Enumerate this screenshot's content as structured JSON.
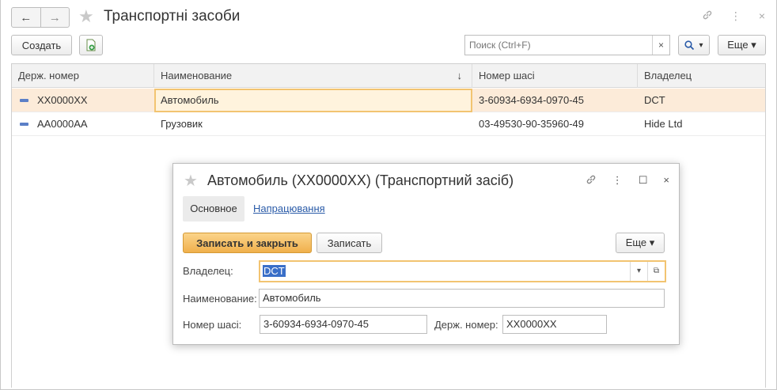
{
  "main": {
    "title": "Транспортні засоби",
    "nav_back": "←",
    "nav_forward": "→",
    "title_icons": {
      "link": "🔗",
      "more": "⋮",
      "close": "×"
    },
    "toolbar": {
      "create_label": "Создать",
      "search_placeholder": "Поиск (Ctrl+F)",
      "search_clear": "×",
      "search_icon": "🔍",
      "search_dropdown": "▾",
      "more_label": "Еще ▾"
    },
    "table": {
      "columns": [
        "Держ. номер",
        "Наименование",
        "Номер шасі",
        "Владелец"
      ],
      "sort_indicator": "↓",
      "rows": [
        {
          "plate": "XX0000XX",
          "name": "Автомобиль",
          "chassis": "3-60934-6934-0970-45",
          "owner": "DCT"
        },
        {
          "plate": "AA0000AA",
          "name": "Грузовик",
          "chassis": "03-49530-90-35960-49",
          "owner": "Hide Ltd"
        }
      ]
    }
  },
  "dialog": {
    "title": "Автомобиль (XX0000XX) (Транспортний засіб)",
    "icons": {
      "link": "🔗",
      "more": "⋮",
      "maximize": "☐",
      "close": "×"
    },
    "tabs": {
      "main": "Основное",
      "link": "Напрацювання"
    },
    "buttons": {
      "save_close": "Записать и закрыть",
      "save": "Записать",
      "more": "Еще ▾"
    },
    "fields": {
      "owner_label": "Владелец:",
      "owner_value": "DCT",
      "name_label": "Наименование:",
      "name_value": "Автомобиль",
      "chassis_label": "Номер шасі:",
      "chassis_value": "3-60934-6934-0970-45",
      "plate_label": "Держ. номер:",
      "plate_value": "XX0000XX",
      "dropdown_glyph": "▾",
      "open_glyph": "⧉"
    }
  },
  "colors": {
    "accent": "#f0b04c",
    "selection_row": "#fcebd9",
    "link": "#2a5ba8"
  }
}
